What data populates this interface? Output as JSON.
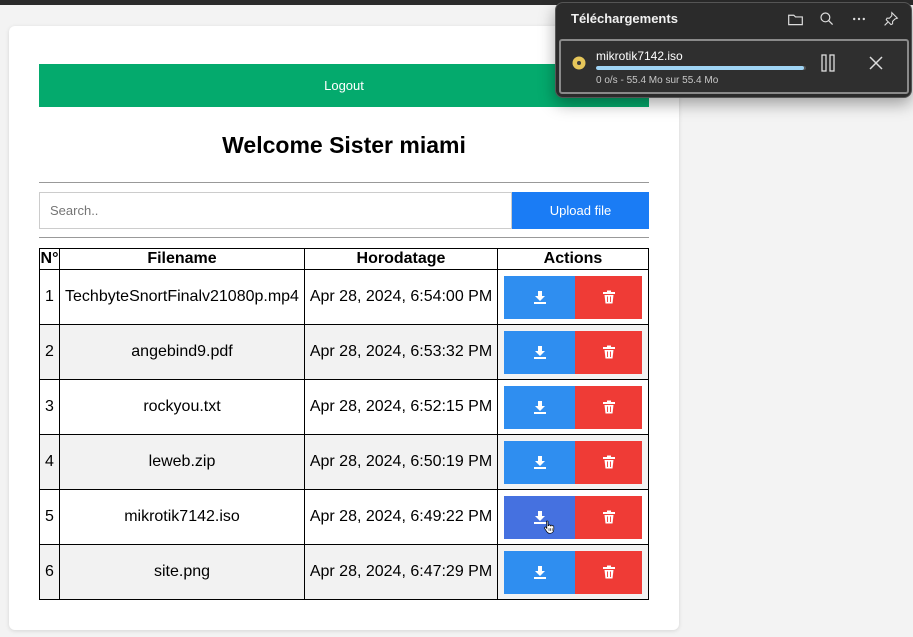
{
  "page": {
    "logout_label": "Logout",
    "welcome": "Welcome Sister miami",
    "search_placeholder": "Search..",
    "upload_label": "Upload file"
  },
  "table": {
    "headers": [
      "N°",
      "Filename",
      "Horodatage",
      "Actions"
    ],
    "rows": [
      {
        "n": "1",
        "filename": "TechbyteSnortFinalv21080p.mp4",
        "time": "Apr 28, 2024, 6:54:00 PM"
      },
      {
        "n": "2",
        "filename": "angebind9.pdf",
        "time": "Apr 28, 2024, 6:53:32 PM"
      },
      {
        "n": "3",
        "filename": "rockyou.txt",
        "time": "Apr 28, 2024, 6:52:15 PM"
      },
      {
        "n": "4",
        "filename": "leweb.zip",
        "time": "Apr 28, 2024, 6:50:19 PM"
      },
      {
        "n": "5",
        "filename": "mikrotik7142.iso",
        "time": "Apr 28, 2024, 6:49:22 PM"
      },
      {
        "n": "6",
        "filename": "site.png",
        "time": "Apr 28, 2024, 6:47:29 PM"
      }
    ],
    "row_icons": {
      "download": "download-icon",
      "delete": "trash-icon"
    }
  },
  "downloads_panel": {
    "title": "Téléchargements",
    "toolbar_icons": [
      "folder-icon",
      "search-icon",
      "more-icon",
      "pin-icon"
    ],
    "item": {
      "name": "mikrotik7142.iso",
      "status": "0 o/s - 55.4 Mo sur 55.4 Mo",
      "progress": 0.99
    }
  },
  "colors": {
    "logout": "#04aa6d",
    "upload": "#1a7cf5",
    "download_button": "#2f8ef0",
    "download_button_hover": "#4571e0",
    "delete_button": "#ef3b36",
    "panel_bg": "#2b2b2b",
    "progress": "#9fd4f5"
  }
}
